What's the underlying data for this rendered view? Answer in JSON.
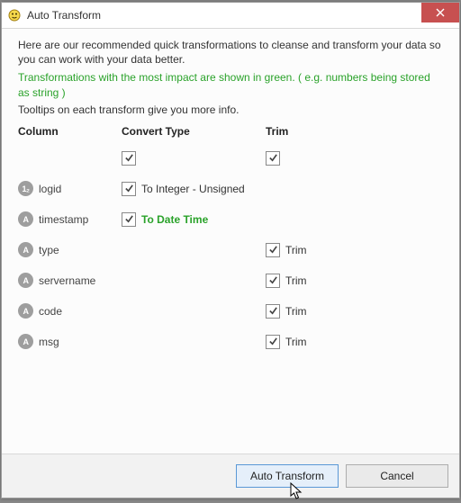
{
  "window": {
    "title": "Auto Transform"
  },
  "text": {
    "intro": "Here are our recommended quick transformations to cleanse and transform your data so you can work with your data better.",
    "impact": "Transformations with the most impact are shown in green. ( e.g. numbers being stored as string )",
    "tooltips": "Tooltips on each transform give you more info."
  },
  "headers": {
    "column": "Column",
    "convert": "Convert Type",
    "trim": "Trim"
  },
  "master": {
    "convert_checked": true,
    "trim_checked": true
  },
  "rows": [
    {
      "icon": "1₂",
      "name": "logid",
      "convert_checked": true,
      "convert_label": "To Integer - Unsigned",
      "convert_green": false,
      "trim_checked": null,
      "trim_label": ""
    },
    {
      "icon": "A",
      "name": "timestamp",
      "convert_checked": true,
      "convert_label": "To Date Time",
      "convert_green": true,
      "trim_checked": null,
      "trim_label": ""
    },
    {
      "icon": "A",
      "name": "type",
      "convert_checked": null,
      "convert_label": "",
      "convert_green": false,
      "trim_checked": true,
      "trim_label": "Trim"
    },
    {
      "icon": "A",
      "name": "servername",
      "convert_checked": null,
      "convert_label": "",
      "convert_green": false,
      "trim_checked": true,
      "trim_label": "Trim"
    },
    {
      "icon": "A",
      "name": "code",
      "convert_checked": null,
      "convert_label": "",
      "convert_green": false,
      "trim_checked": true,
      "trim_label": "Trim"
    },
    {
      "icon": "A",
      "name": "msg",
      "convert_checked": null,
      "convert_label": "",
      "convert_green": false,
      "trim_checked": true,
      "trim_label": "Trim"
    }
  ],
  "buttons": {
    "auto": "Auto Transform",
    "cancel": "Cancel"
  }
}
